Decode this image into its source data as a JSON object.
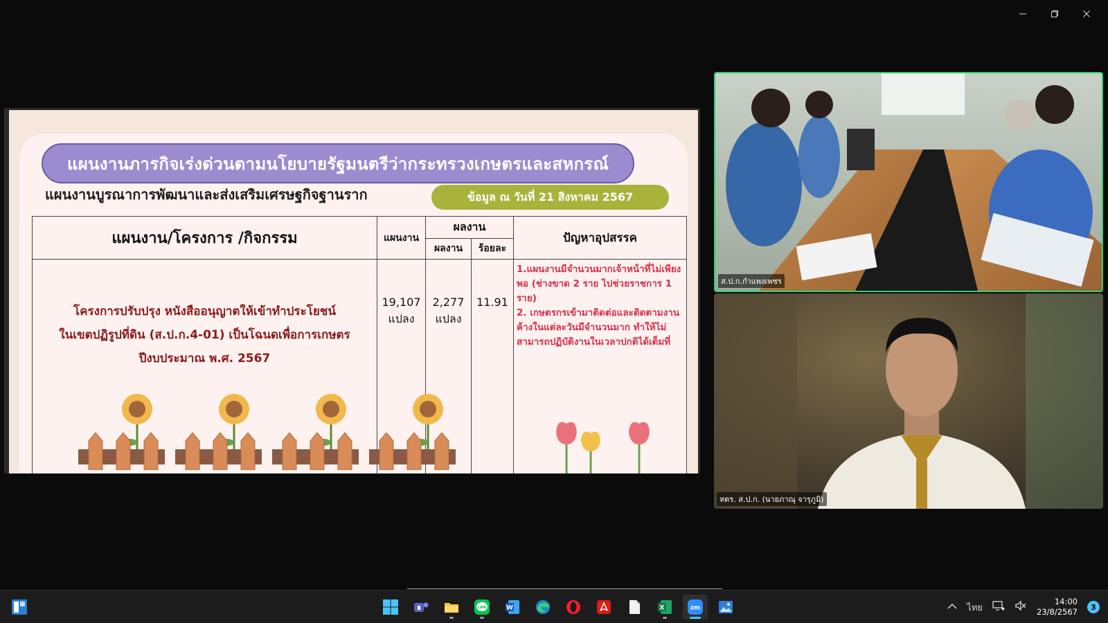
{
  "window": {
    "minimize_icon": "minimize-icon",
    "restore_icon": "restore-icon",
    "close_icon": "close-icon"
  },
  "slide": {
    "banner": "แผนงานภารกิจเร่งด่วนตามนโยบายรัฐมนตรีว่ากระทรวงเกษตรและสหกรณ์",
    "subtitle": "แผนงานบูรณาการพัฒนาและส่งเสริมเศรษฐกิจฐานราก",
    "date": "ข้อมูล ณ วันที่ 21 สิงหาคม 2567",
    "table": {
      "headers": {
        "main": "แผนงาน/โครงการ /กิจกรรม",
        "plan": "แผนงาน",
        "results": "ผลงาน",
        "result_sub": "ผลงาน",
        "percent": "ร้อยละ",
        "problems": "ปัญหาอุปสรรค"
      },
      "row": {
        "project_line1": "โครงการปรับปรุง หนังสืออนุญาตให้เข้าทำประโยชน์",
        "project_line2": "ในเขตปฏิรูปที่ดิน (ส.ป.ก.4-01) เป็นโฉนดเพื่อการเกษตร",
        "project_line3": "ปีงบประมาณ พ.ศ. 2567",
        "plan_value": "19,107",
        "plan_unit": "แปลง",
        "result_value": "2,277",
        "result_unit": "แปลง",
        "percent_value": "11.91",
        "problem_1": "1.แผนงานมีจำนวนมากเจ้าหน้าที่ไม่เพียงพอ (ช่างขาด 2 ราย ไปช่วยราชการ 1 ราย)",
        "problem_2": "2. เกษตรกรเข้ามาติดต่อและติดตามงานค้างในแต่ละวันมีจำนวนมาก ทำให้ไม่สามารถปฏิบัติงานในเวลาปกติได้เต็มที่"
      }
    }
  },
  "participants": [
    {
      "label": "ส.ป.ก.กำแพงเพชร"
    },
    {
      "label": "หตร. ส.ป.ก. (นายภาณุ  จารุภูมิ)"
    }
  ],
  "taskbar": {
    "apps": [
      "windows-start",
      "teams",
      "file-explorer",
      "line",
      "word",
      "edge",
      "opera",
      "acrobat",
      "notepad",
      "excel",
      "zoom",
      "photos"
    ],
    "tray_language": "ไทย",
    "time": "14:00",
    "date": "23/8/2567",
    "notifications": "3"
  },
  "colors": {
    "banner": "#9b8ccf",
    "date_pill": "#a7b33b",
    "problem_text": "#d7304a",
    "project_text": "#8b1a1a",
    "active_speaker": "#2fd36e"
  }
}
